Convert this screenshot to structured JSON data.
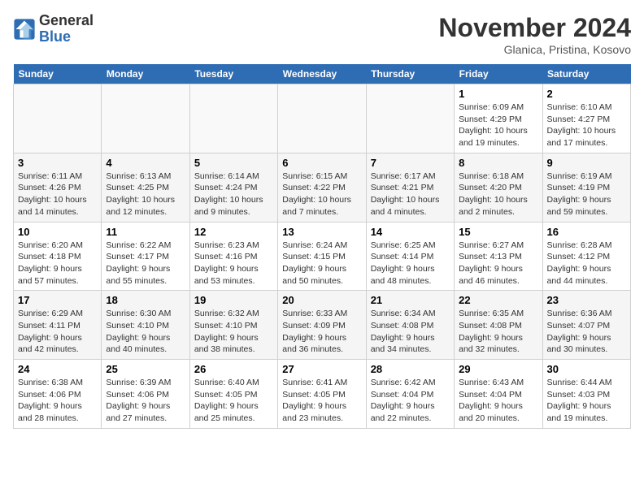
{
  "header": {
    "logo_line1": "General",
    "logo_line2": "Blue",
    "month_year": "November 2024",
    "location": "Glanica, Pristina, Kosovo"
  },
  "weekdays": [
    "Sunday",
    "Monday",
    "Tuesday",
    "Wednesday",
    "Thursday",
    "Friday",
    "Saturday"
  ],
  "weeks": [
    [
      {
        "day": "",
        "info": ""
      },
      {
        "day": "",
        "info": ""
      },
      {
        "day": "",
        "info": ""
      },
      {
        "day": "",
        "info": ""
      },
      {
        "day": "",
        "info": ""
      },
      {
        "day": "1",
        "info": "Sunrise: 6:09 AM\nSunset: 4:29 PM\nDaylight: 10 hours and 19 minutes."
      },
      {
        "day": "2",
        "info": "Sunrise: 6:10 AM\nSunset: 4:27 PM\nDaylight: 10 hours and 17 minutes."
      }
    ],
    [
      {
        "day": "3",
        "info": "Sunrise: 6:11 AM\nSunset: 4:26 PM\nDaylight: 10 hours and 14 minutes."
      },
      {
        "day": "4",
        "info": "Sunrise: 6:13 AM\nSunset: 4:25 PM\nDaylight: 10 hours and 12 minutes."
      },
      {
        "day": "5",
        "info": "Sunrise: 6:14 AM\nSunset: 4:24 PM\nDaylight: 10 hours and 9 minutes."
      },
      {
        "day": "6",
        "info": "Sunrise: 6:15 AM\nSunset: 4:22 PM\nDaylight: 10 hours and 7 minutes."
      },
      {
        "day": "7",
        "info": "Sunrise: 6:17 AM\nSunset: 4:21 PM\nDaylight: 10 hours and 4 minutes."
      },
      {
        "day": "8",
        "info": "Sunrise: 6:18 AM\nSunset: 4:20 PM\nDaylight: 10 hours and 2 minutes."
      },
      {
        "day": "9",
        "info": "Sunrise: 6:19 AM\nSunset: 4:19 PM\nDaylight: 9 hours and 59 minutes."
      }
    ],
    [
      {
        "day": "10",
        "info": "Sunrise: 6:20 AM\nSunset: 4:18 PM\nDaylight: 9 hours and 57 minutes."
      },
      {
        "day": "11",
        "info": "Sunrise: 6:22 AM\nSunset: 4:17 PM\nDaylight: 9 hours and 55 minutes."
      },
      {
        "day": "12",
        "info": "Sunrise: 6:23 AM\nSunset: 4:16 PM\nDaylight: 9 hours and 53 minutes."
      },
      {
        "day": "13",
        "info": "Sunrise: 6:24 AM\nSunset: 4:15 PM\nDaylight: 9 hours and 50 minutes."
      },
      {
        "day": "14",
        "info": "Sunrise: 6:25 AM\nSunset: 4:14 PM\nDaylight: 9 hours and 48 minutes."
      },
      {
        "day": "15",
        "info": "Sunrise: 6:27 AM\nSunset: 4:13 PM\nDaylight: 9 hours and 46 minutes."
      },
      {
        "day": "16",
        "info": "Sunrise: 6:28 AM\nSunset: 4:12 PM\nDaylight: 9 hours and 44 minutes."
      }
    ],
    [
      {
        "day": "17",
        "info": "Sunrise: 6:29 AM\nSunset: 4:11 PM\nDaylight: 9 hours and 42 minutes."
      },
      {
        "day": "18",
        "info": "Sunrise: 6:30 AM\nSunset: 4:10 PM\nDaylight: 9 hours and 40 minutes."
      },
      {
        "day": "19",
        "info": "Sunrise: 6:32 AM\nSunset: 4:10 PM\nDaylight: 9 hours and 38 minutes."
      },
      {
        "day": "20",
        "info": "Sunrise: 6:33 AM\nSunset: 4:09 PM\nDaylight: 9 hours and 36 minutes."
      },
      {
        "day": "21",
        "info": "Sunrise: 6:34 AM\nSunset: 4:08 PM\nDaylight: 9 hours and 34 minutes."
      },
      {
        "day": "22",
        "info": "Sunrise: 6:35 AM\nSunset: 4:08 PM\nDaylight: 9 hours and 32 minutes."
      },
      {
        "day": "23",
        "info": "Sunrise: 6:36 AM\nSunset: 4:07 PM\nDaylight: 9 hours and 30 minutes."
      }
    ],
    [
      {
        "day": "24",
        "info": "Sunrise: 6:38 AM\nSunset: 4:06 PM\nDaylight: 9 hours and 28 minutes."
      },
      {
        "day": "25",
        "info": "Sunrise: 6:39 AM\nSunset: 4:06 PM\nDaylight: 9 hours and 27 minutes."
      },
      {
        "day": "26",
        "info": "Sunrise: 6:40 AM\nSunset: 4:05 PM\nDaylight: 9 hours and 25 minutes."
      },
      {
        "day": "27",
        "info": "Sunrise: 6:41 AM\nSunset: 4:05 PM\nDaylight: 9 hours and 23 minutes."
      },
      {
        "day": "28",
        "info": "Sunrise: 6:42 AM\nSunset: 4:04 PM\nDaylight: 9 hours and 22 minutes."
      },
      {
        "day": "29",
        "info": "Sunrise: 6:43 AM\nSunset: 4:04 PM\nDaylight: 9 hours and 20 minutes."
      },
      {
        "day": "30",
        "info": "Sunrise: 6:44 AM\nSunset: 4:03 PM\nDaylight: 9 hours and 19 minutes."
      }
    ]
  ]
}
